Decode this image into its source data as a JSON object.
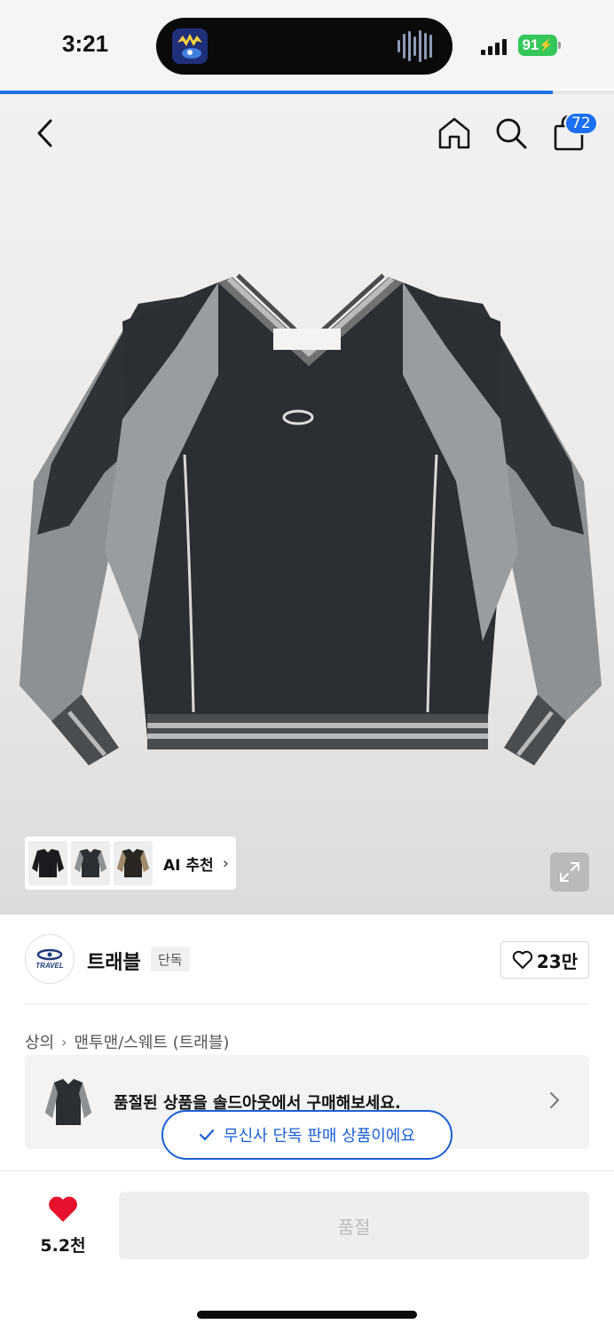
{
  "status_bar": {
    "time": "3:21",
    "battery": "91"
  },
  "page_load_progress": 0.9,
  "header": {
    "cart_count": "72",
    "icons": [
      "chevron-left-icon",
      "home-icon",
      "search-icon",
      "shopping-bag-icon"
    ]
  },
  "gallery": {
    "ai_label": "AI 추천",
    "thumbnail_count": 3,
    "expand_icon": "expand-icon"
  },
  "brand": {
    "logo_text": "TRAVEL",
    "name": "트래블",
    "tag": "단독",
    "likes": "23만"
  },
  "breadcrumb": [
    "상의",
    "맨투맨/스웨트 (트래블)"
  ],
  "soldout_notice": "품절된 상품을 솔드아웃에서 구매해보세요.",
  "exclusive_badge": "무신사 단독 판매 상품이에요",
  "bottom_bar": {
    "wishlist_count": "5.2천",
    "buy_label": "품절"
  },
  "colors": {
    "accent_blue": "#1a5fd6",
    "badge_blue": "#1a6ff2",
    "heart_red": "#e8112d",
    "battery_green": "#34c759"
  }
}
